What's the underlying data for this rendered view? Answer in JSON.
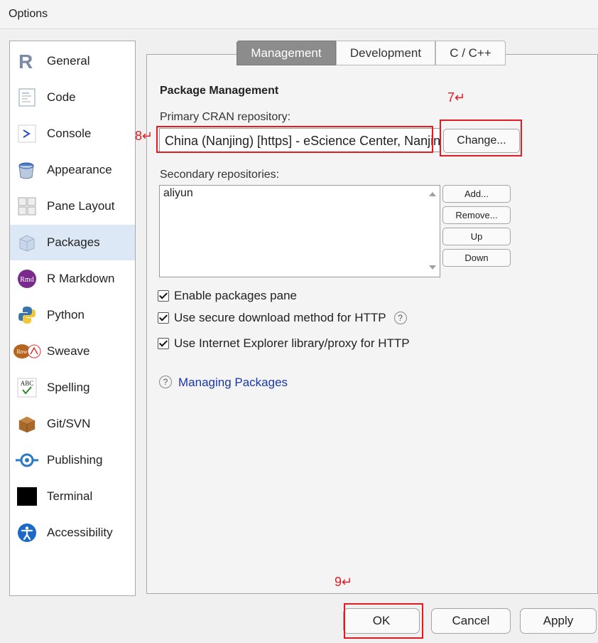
{
  "window": {
    "title": "Options"
  },
  "sidebar": {
    "items": [
      {
        "label": "General",
        "icon": "r-logo-icon"
      },
      {
        "label": "Code",
        "icon": "code-document-icon"
      },
      {
        "label": "Console",
        "icon": "console-prompt-icon"
      },
      {
        "label": "Appearance",
        "icon": "paint-bucket-icon"
      },
      {
        "label": "Pane Layout",
        "icon": "pane-layout-icon"
      },
      {
        "label": "Packages",
        "icon": "package-box-icon"
      },
      {
        "label": "R Markdown",
        "icon": "rmd-icon"
      },
      {
        "label": "Python",
        "icon": "python-icon"
      },
      {
        "label": "Sweave",
        "icon": "sweave-icon"
      },
      {
        "label": "Spelling",
        "icon": "spelling-abc-icon"
      },
      {
        "label": "Git/SVN",
        "icon": "git-box-icon"
      },
      {
        "label": "Publishing",
        "icon": "publishing-icon"
      },
      {
        "label": "Terminal",
        "icon": "terminal-icon"
      },
      {
        "label": "Accessibility",
        "icon": "accessibility-icon"
      }
    ],
    "selected": "Packages"
  },
  "tabs": [
    "Management",
    "Development",
    "C / C++"
  ],
  "active_tab": "Management",
  "main": {
    "section_title": "Package Management",
    "cran_label": "Primary CRAN repository:",
    "cran_value": "China (Nanjing) [https] - eScience Center, Nanjing University",
    "change_button": "Change...",
    "secondary_label": "Secondary repositories:",
    "secondary_items": [
      "aliyun"
    ],
    "side_buttons": {
      "add": "Add...",
      "remove": "Remove...",
      "up": "Up",
      "down": "Down"
    },
    "checkboxes": [
      {
        "label": "Enable packages pane",
        "checked": true
      },
      {
        "label": "Use secure download method for HTTP",
        "checked": true
      },
      {
        "label": "Use Internet Explorer library/proxy for HTTP",
        "checked": true
      }
    ],
    "help_link": "Managing Packages"
  },
  "annotations": {
    "seven": "7↵",
    "eight": "8↵",
    "nine": "9↵",
    "color": "#e31b23"
  },
  "buttons": {
    "ok": "OK",
    "cancel": "Cancel",
    "apply": "Apply"
  },
  "colors": {
    "selected_bg": "#dce8f5",
    "active_tab": "#8c8c8c",
    "link": "#1a37a7"
  }
}
